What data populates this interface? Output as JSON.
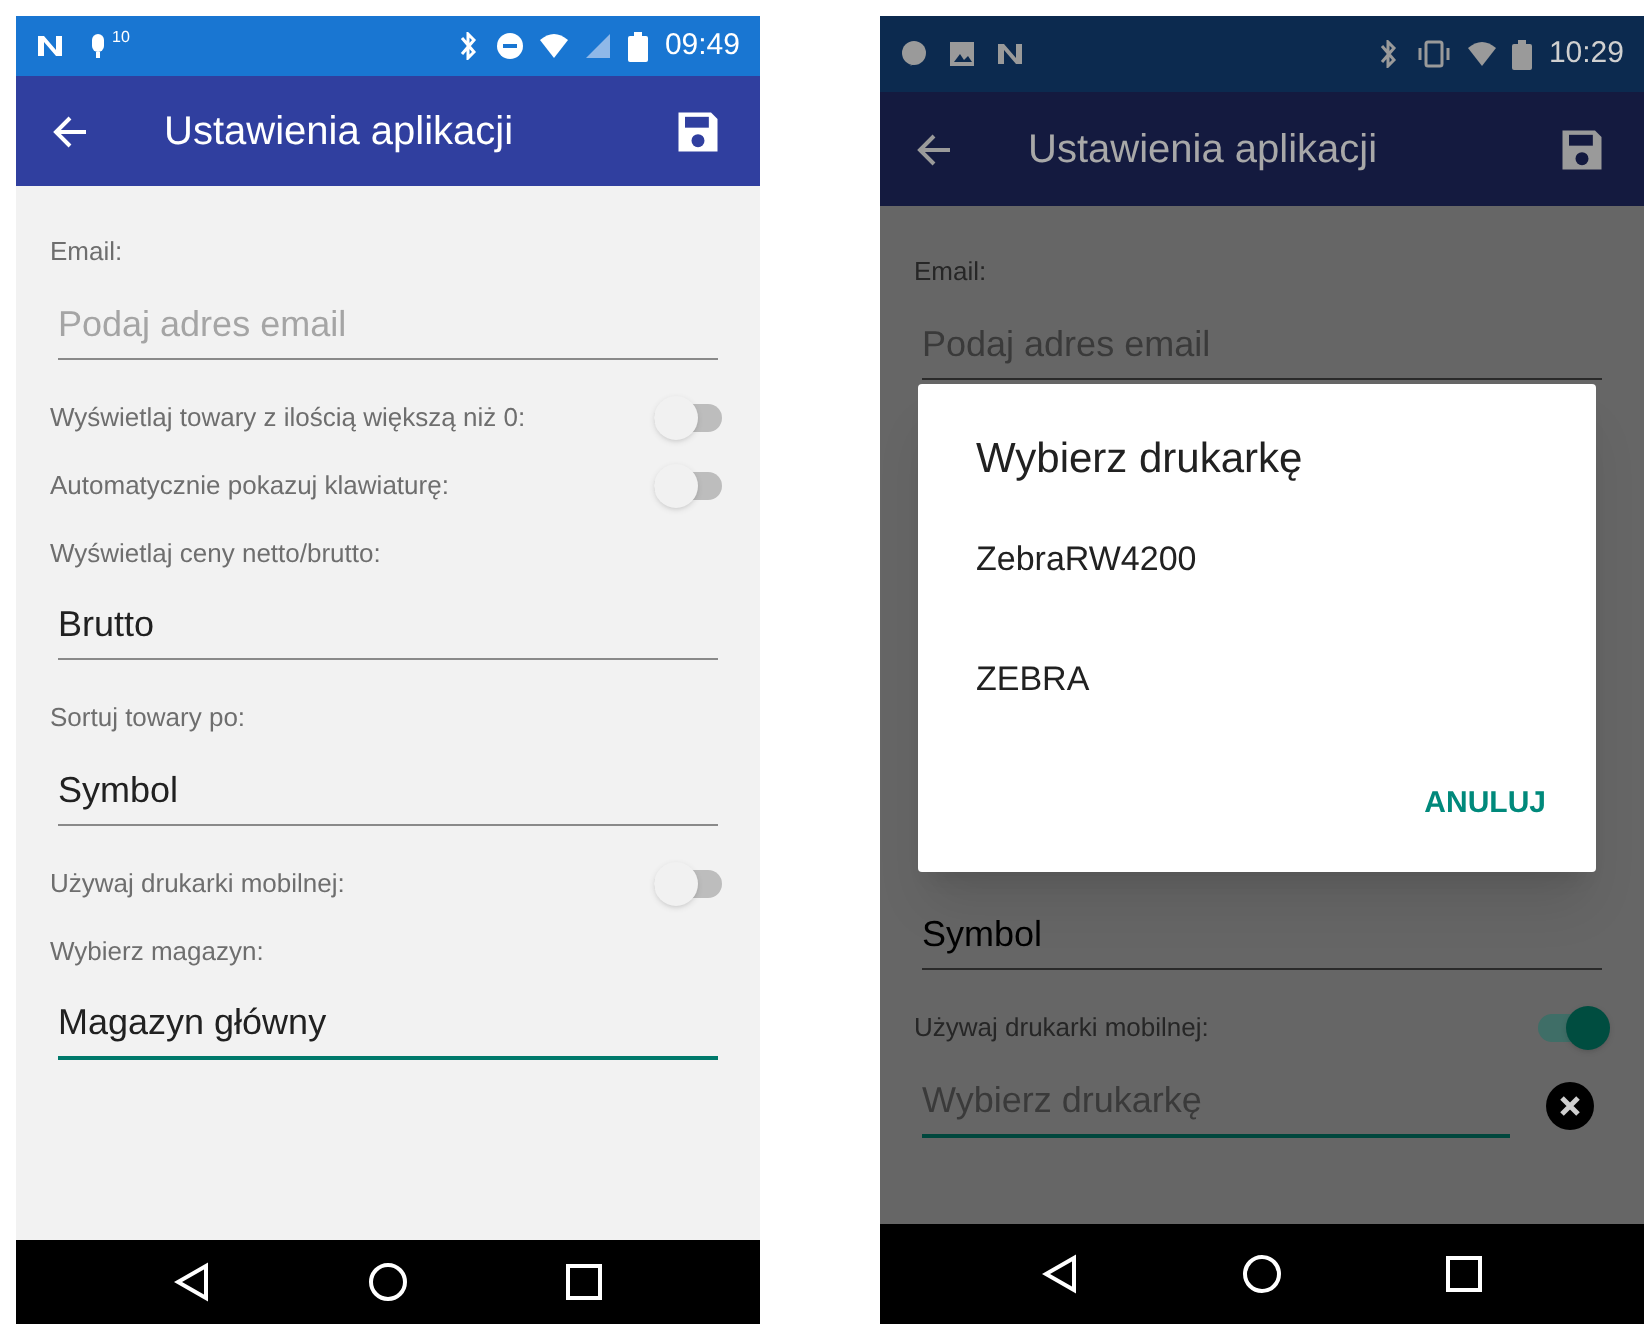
{
  "screens": [
    {
      "status_bar": {
        "superscript": "10",
        "time": "09:49"
      },
      "app_bar": {
        "title": "Ustawienia aplikacji"
      },
      "settings": [
        {
          "kind": "label",
          "text": "Email:"
        },
        {
          "kind": "field",
          "placeholder": "Podaj adres email",
          "focused": false
        },
        {
          "kind": "toggle",
          "label": "Wyświetlaj towary z ilością większą niż 0:",
          "on": false
        },
        {
          "kind": "toggle",
          "label": "Automatycznie pokazuj klawiaturę:",
          "on": false
        },
        {
          "kind": "label",
          "text": "Wyświetlaj ceny netto/brutto:"
        },
        {
          "kind": "field",
          "value": "Brutto",
          "focused": false
        },
        {
          "kind": "label",
          "text": "Sortuj towary po:"
        },
        {
          "kind": "field",
          "value": "Symbol",
          "focused": false
        },
        {
          "kind": "toggle",
          "label": "Używaj drukarki mobilnej:",
          "on": false
        },
        {
          "kind": "label",
          "text": "Wybierz magazyn:"
        },
        {
          "kind": "field",
          "value": "Magazyn główny",
          "focused": true
        }
      ]
    },
    {
      "status_bar": {
        "time": "10:29"
      },
      "app_bar": {
        "title": "Ustawienia aplikacji"
      },
      "settings": [
        {
          "kind": "label",
          "text": "Email:"
        },
        {
          "kind": "field",
          "placeholder": "Podaj adres email",
          "focused": false
        }
      ],
      "dialog": {
        "title": "Wybierz drukarkę",
        "options": [
          "ZebraRW4200",
          "ZEBRA"
        ],
        "button": "ANULUJ"
      },
      "settings_below_dialog": [
        {
          "kind": "field",
          "value": "Symbol",
          "focused": false
        },
        {
          "kind": "toggle",
          "label": "Używaj drukarki mobilnej:",
          "on": true
        },
        {
          "kind": "field",
          "placeholder": "Wybierz drukarkę",
          "focused": true,
          "clear_button": true
        }
      ]
    }
  ]
}
